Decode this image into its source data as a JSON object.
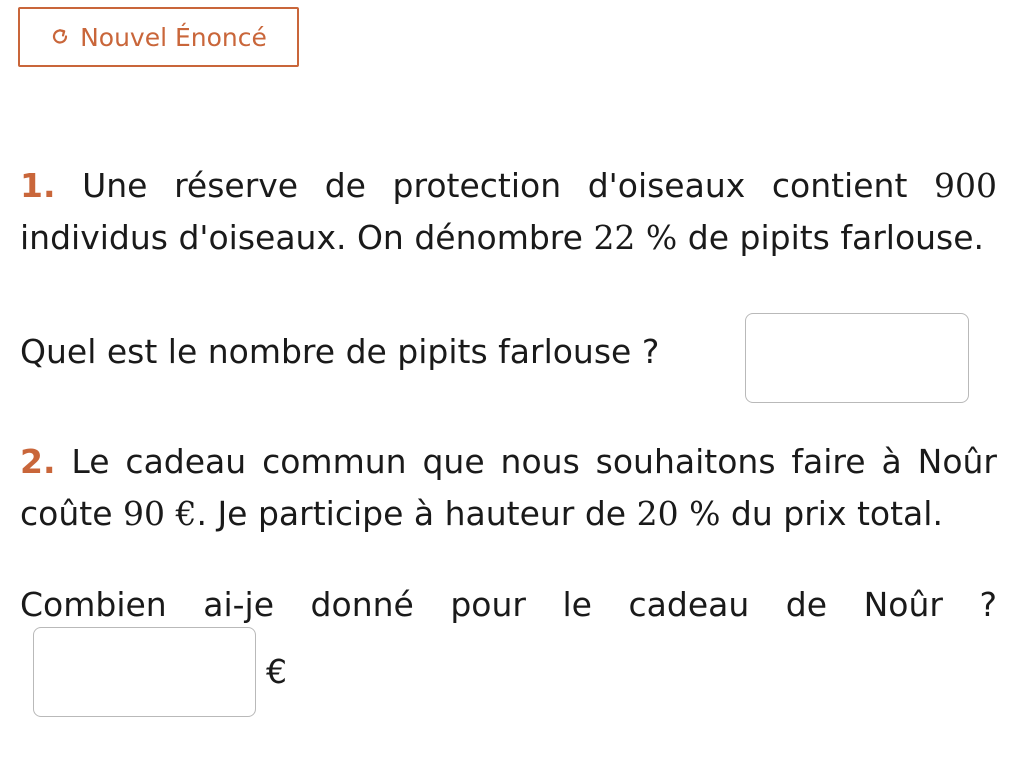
{
  "header": {
    "new_button_label": "Nouvel Énoncé",
    "new_button_icon": "refresh-icon",
    "accent_color": "#c9663a"
  },
  "exercise1": {
    "number": "1.",
    "text_a": " Une réserve de protection d'oiseaux contient ",
    "total_birds": "900",
    "text_b": " individus d'oiseaux. On dénombre ",
    "percent": "22 %",
    "text_c": " de pipits farlouse.",
    "question": "Quel est le nombre de pipits farlouse ?",
    "answer_value": ""
  },
  "exercise2": {
    "number": "2.",
    "text_a": " Le cadeau commun que nous souhaitons faire à Noûr coûte ",
    "price": "90 €",
    "text_b": ". Je participe à hauteur de ",
    "percent": "20 %",
    "text_c": " du prix total.",
    "question": "Combien ai-je donné pour le cadeau de Noûr ?",
    "answer_value": "",
    "unit": "€"
  }
}
